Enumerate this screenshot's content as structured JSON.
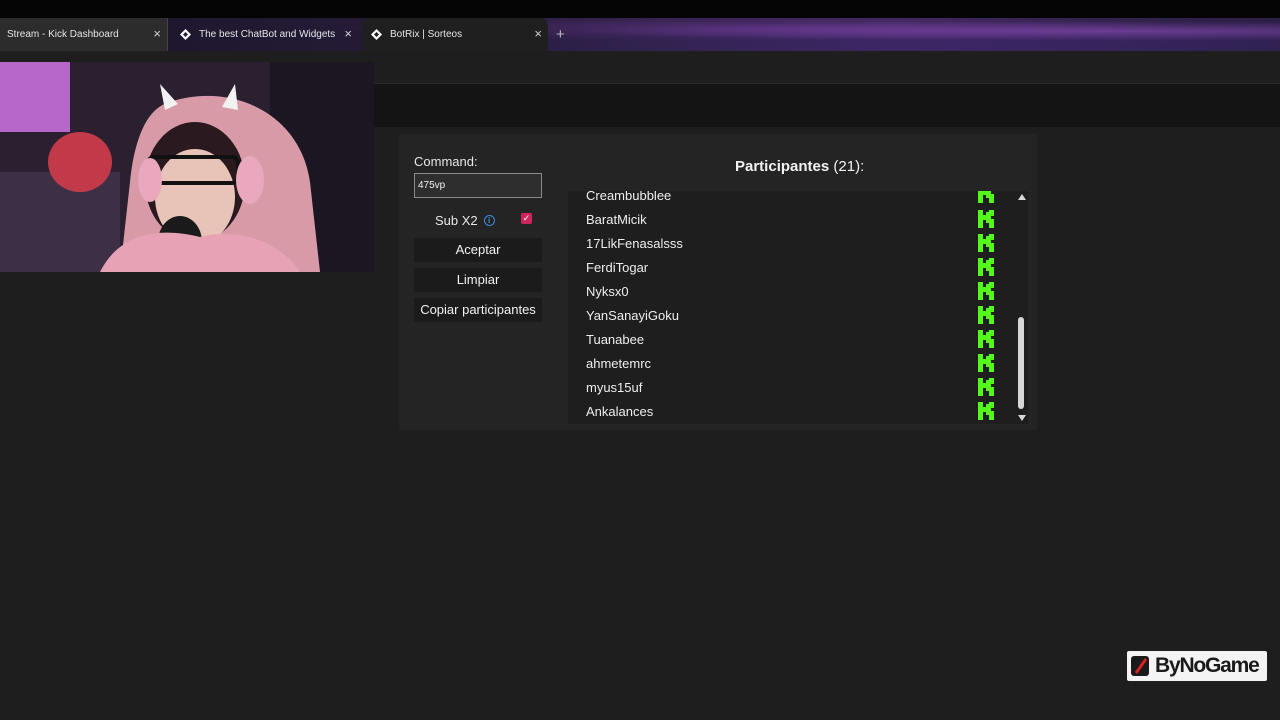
{
  "browser": {
    "tabs": [
      {
        "label": "Stream - Kick Dashboard",
        "active": false
      },
      {
        "label": "The best ChatBot and Widgets",
        "active": false
      },
      {
        "label": "BotRix | Sorteos",
        "active": true
      }
    ],
    "new_tab_symbol": "+",
    "close_symbol": "×"
  },
  "giveaway": {
    "command_label": "Command:",
    "command_value": "475vp",
    "sub_label": "Sub X2",
    "sub_checked": true,
    "buttons": {
      "accept": "Aceptar",
      "clear": "Limpiar",
      "copy": "Copiar participantes"
    },
    "participants_title": "Participantes",
    "participants_count": "(21):",
    "participants": [
      "Creambubblee",
      "BaratMicik",
      "17LikFenasalsss",
      "FerdiTogar",
      "Nyksx0",
      "YanSanayiGoku",
      "Tuanabee",
      "ahmetemrc",
      "myus15uf",
      "Ankalances"
    ],
    "platform_icon": "kick-icon",
    "accent_color": "#53fc18",
    "checkbox_color": "#d0245c"
  },
  "watermark": {
    "text": "ByNoGame"
  }
}
